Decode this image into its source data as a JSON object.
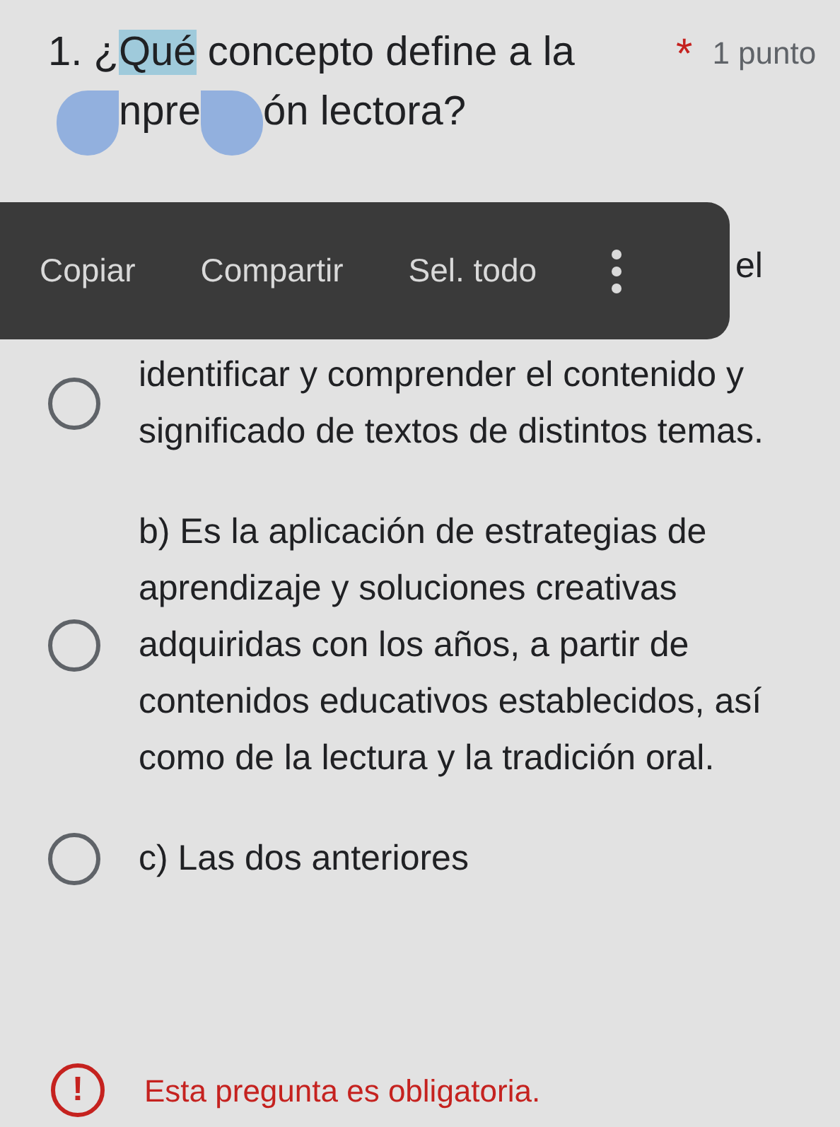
{
  "question": {
    "number": "1.",
    "before": "¿",
    "selected_text": "Qué",
    "after": " concepto define a la",
    "line2_fragments": [
      "npre",
      "ón lectora?"
    ],
    "required_mark": "*",
    "points": "1 punto",
    "selection_handles": true
  },
  "context_menu": {
    "items": [
      {
        "label": "Copiar"
      },
      {
        "label": "Compartir"
      },
      {
        "label": "Sel. todo"
      }
    ],
    "more": true
  },
  "options": [
    {
      "partial_text": "el",
      "text": "identificar y comprender el contenido y significado de textos de distintos temas.",
      "selected": false
    },
    {
      "text": "b) Es la aplicación de estrategias de aprendizaje y soluciones creativas adquiridas con los años, a partir de contenidos educativos establecidos, así como de la lectura y la tradición oral.",
      "selected": false
    },
    {
      "text": "c) Las dos anteriores",
      "selected": false
    }
  ],
  "error": {
    "icon": "!",
    "message": "Esta pregunta es obligatoria."
  }
}
